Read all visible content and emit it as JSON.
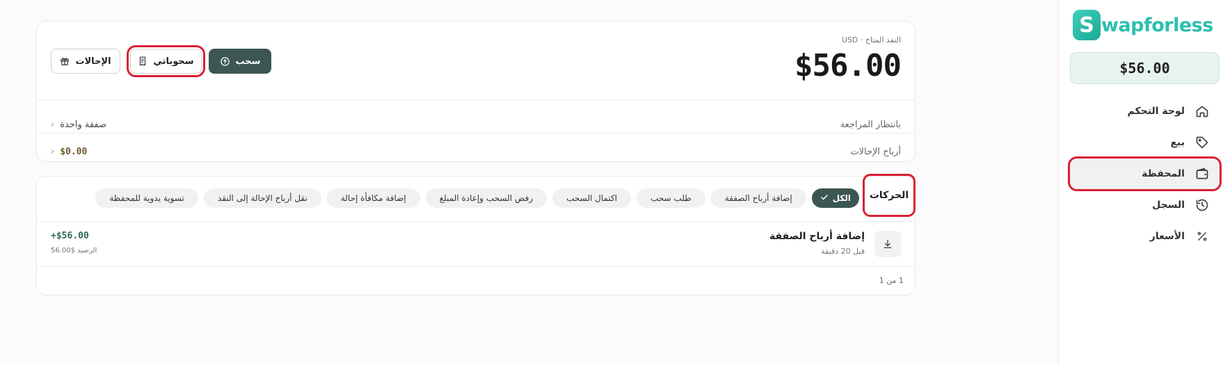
{
  "sidebar": {
    "logo_letter": "S",
    "logo_text": "wapforless",
    "balance": "$56.00",
    "items": [
      {
        "label": "لوحة التحكم",
        "icon": "home-icon"
      },
      {
        "label": "بيع",
        "icon": "tag-icon"
      },
      {
        "label": "المحفظة",
        "icon": "wallet-icon",
        "active": true
      },
      {
        "label": "السجل",
        "icon": "history-icon"
      },
      {
        "label": "الأسعار",
        "icon": "percent-icon"
      }
    ]
  },
  "wallet": {
    "available_label": "النقد المتاح · USD",
    "available_amount": "$56.00",
    "withdraw_label": "سحب",
    "my_withdrawals_label": "سحوباتي",
    "referrals_label": "الإحالات",
    "pending_label": "بانتظار المراجعة",
    "pending_value": "صفقة واحدة",
    "referral_earnings_label": "أرباح الإحالات",
    "referral_earnings_value": "$0.00"
  },
  "transactions": {
    "title": "الحركات",
    "filters": [
      {
        "label": "الكل",
        "active": true
      },
      {
        "label": "إضافة أرباح الصفقة"
      },
      {
        "label": "طلب سحب"
      },
      {
        "label": "اكتمال السحب"
      },
      {
        "label": "رفض السحب وإعادة المبلغ"
      },
      {
        "label": "إضافة مكافأة إحالة"
      },
      {
        "label": "نقل أرباح الإحالة إلى النقد"
      },
      {
        "label": "تسوية يدوية للمحفظة"
      }
    ],
    "rows": [
      {
        "name": "إضافة أرباح الصفقة",
        "time": "قبل 20 دقيقة",
        "amount": "+$56.00",
        "balance": "الرصيد $56.00",
        "icon": "download-icon"
      }
    ],
    "pagination": "1 من 1"
  },
  "colors": {
    "brand": "#2cbfad",
    "primary_button": "#3c5752",
    "highlight_outline": "#d92032"
  }
}
